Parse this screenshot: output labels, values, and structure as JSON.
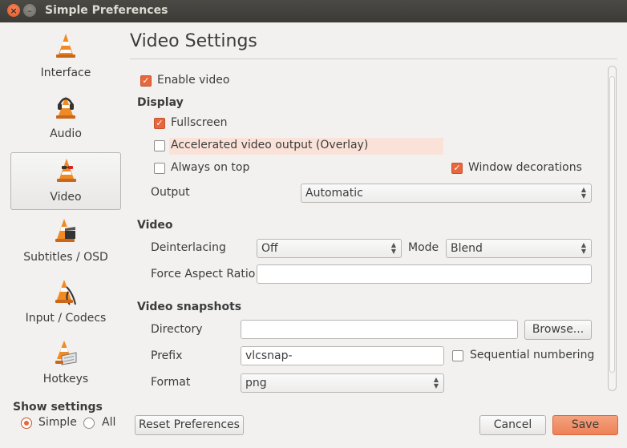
{
  "window": {
    "title": "Simple Preferences"
  },
  "sidebar": {
    "items": [
      {
        "label": "Interface",
        "icon": "vlc-cone-icon"
      },
      {
        "label": "Audio",
        "icon": "vlc-headphones-icon"
      },
      {
        "label": "Video",
        "icon": "vlc-glasses-icon",
        "selected": true
      },
      {
        "label": "Subtitles / OSD",
        "icon": "vlc-clapper-icon"
      },
      {
        "label": "Input / Codecs",
        "icon": "vlc-cables-icon"
      },
      {
        "label": "Hotkeys",
        "icon": "vlc-keyboard-icon"
      }
    ],
    "show_settings": {
      "label": "Show settings",
      "simple": "Simple",
      "all": "All",
      "selected": "Simple"
    }
  },
  "page": {
    "title": "Video Settings",
    "enable_video": {
      "label": "Enable video",
      "checked": true
    },
    "display": {
      "heading": "Display",
      "fullscreen": {
        "label": "Fullscreen",
        "checked": true
      },
      "overlay": {
        "label": "Accelerated video output (Overlay)",
        "checked": false
      },
      "always_on_top": {
        "label": "Always on top",
        "checked": false
      },
      "window_decorations": {
        "label": "Window decorations",
        "checked": true
      },
      "output": {
        "label": "Output",
        "value": "Automatic"
      }
    },
    "video": {
      "heading": "Video",
      "deinterlacing": {
        "label": "Deinterlacing",
        "value": "Off"
      },
      "mode": {
        "label": "Mode",
        "value": "Blend"
      },
      "aspect": {
        "label": "Force Aspect Ratio",
        "value": ""
      }
    },
    "snapshots": {
      "heading": "Video snapshots",
      "directory": {
        "label": "Directory",
        "value": "",
        "browse": "Browse..."
      },
      "prefix": {
        "label": "Prefix",
        "value": "vlcsnap-"
      },
      "sequential": {
        "label": "Sequential numbering",
        "checked": false
      },
      "format": {
        "label": "Format",
        "value": "png"
      }
    }
  },
  "footer": {
    "reset": "Reset Preferences",
    "cancel": "Cancel",
    "save": "Save"
  },
  "colors": {
    "accent": "#e8673c",
    "highlight": "#fbe2d8",
    "titlebar": "#3c3b37"
  }
}
